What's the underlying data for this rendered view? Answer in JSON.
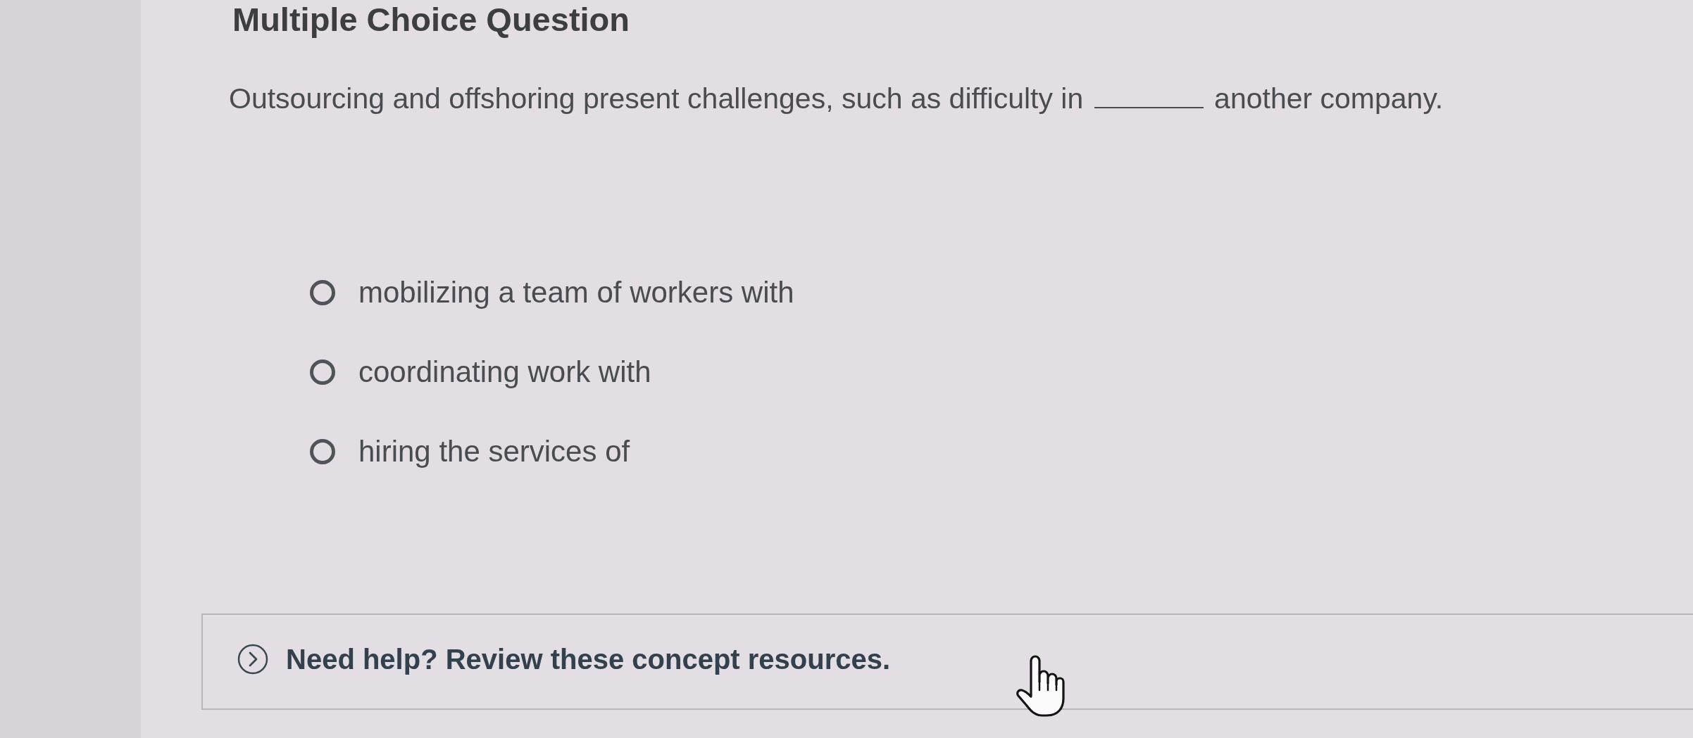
{
  "title": "Multiple Choice Question",
  "question": {
    "before": "Outsourcing and offshoring present challenges, such as difficulty in",
    "after": "another company."
  },
  "options": [
    {
      "label": "mobilizing a team of workers with",
      "selected": false
    },
    {
      "label": "coordinating work with",
      "selected": false
    },
    {
      "label": "hiring the services of",
      "selected": false
    }
  ],
  "help": {
    "label": "Need help? Review these concept resources.",
    "expanded": false
  }
}
